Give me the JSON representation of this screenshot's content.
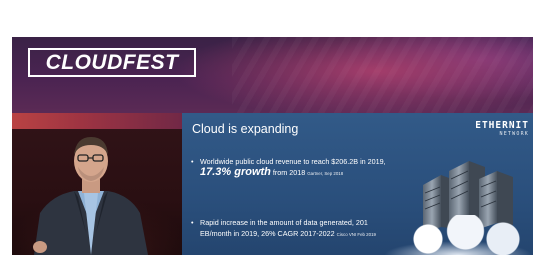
{
  "banner": {
    "logo_text": "CLOUDFEST"
  },
  "slide": {
    "title": "Cloud is expanding",
    "brand_line1": "ETHERNIT",
    "brand_line2": "NETWORK",
    "bullet1": {
      "text_part1": "Worldwide public cloud revenue to reach $206.2B in 2019, ",
      "growth": "17.3% growth",
      "text_part2": " from 2018 ",
      "source": "Gartner, Sep 2018"
    },
    "bullet2": {
      "text_part1": "Rapid increase in the amount of data generated, 201 EB/month in 2019, 26% CAGR 2017-2022 ",
      "source": "Cisco VNI Feb 2019"
    }
  },
  "colors": {
    "slide_bg": "#2f5683",
    "banner_accent": "#a33d6a"
  }
}
